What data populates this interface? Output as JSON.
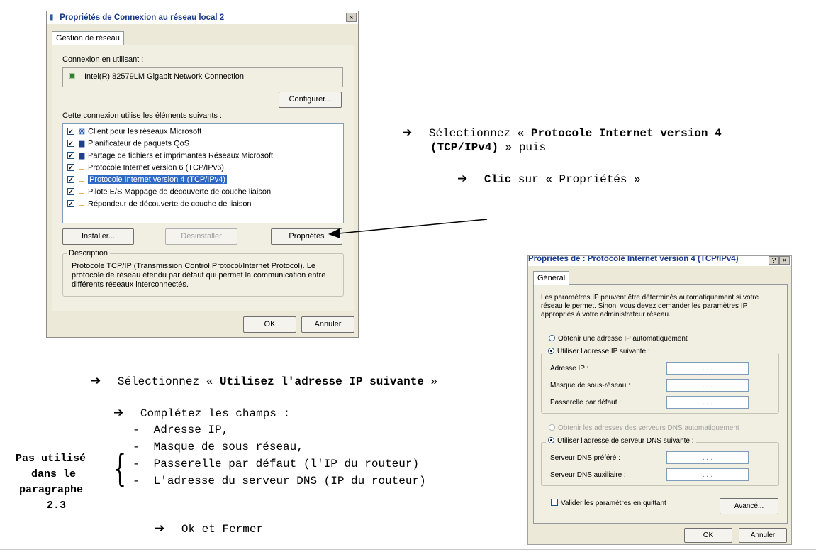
{
  "dialog1": {
    "title": "Propriétés de Connexion au réseau local 2",
    "close_glyph": "×",
    "tab": "Gestion de réseau",
    "connect_using_label": "Connexion en utilisant :",
    "adapter_name": "Intel(R) 82579LM Gigabit Network Connection",
    "configure_button": "Configurer...",
    "items_label": "Cette connexion utilise les éléments suivants :",
    "items": [
      {
        "label": "Client pour les réseaux Microsoft",
        "checked": true,
        "icon": "network-client-icon"
      },
      {
        "label": "Planificateur de paquets QoS",
        "checked": true,
        "icon": "computer-icon"
      },
      {
        "label": "Partage de fichiers et imprimantes Réseaux Microsoft",
        "checked": true,
        "icon": "computer-icon"
      },
      {
        "label": "Protocole Internet version 6 (TCP/IPv6)",
        "checked": true,
        "icon": "protocol-icon"
      },
      {
        "label": "Protocole Internet version 4 (TCP/IPv4)",
        "checked": true,
        "icon": "protocol-icon"
      },
      {
        "label": "Pilote E/S Mappage de découverte de couche liaison",
        "checked": true,
        "icon": "protocol-icon"
      },
      {
        "label": "Répondeur de découverte de couche de liaison",
        "checked": true,
        "icon": "protocol-icon"
      }
    ],
    "selected_item": 4,
    "install_button": "Installer...",
    "uninstall_button": "Désinstaller",
    "properties_button": "Propriétés",
    "description_label": "Description",
    "description_text_1": "Protocole TCP/IP (Transmission Control Protocol/Internet Protocol). Le",
    "description_text_2": "protocole de réseau étendu par défaut qui permet la communication entre",
    "description_text_3": "différents réseaux interconnectés.",
    "ok_button": "OK",
    "cancel_button": "Annuler"
  },
  "dialog2": {
    "title": "Propriétés de : Protocole Internet version 4 (TCP/IPv4)",
    "help_glyph": "?",
    "close_glyph": "×",
    "tab": "Général",
    "intro_1": "Les paramètres IP peuvent être déterminés automatiquement si votre",
    "intro_2": "réseau le permet. Sinon, vous devez demander les paramètres IP",
    "intro_3": "appropriés à votre administrateur réseau.",
    "auto_ip_radio": "Obtenir une adresse IP automatiquement",
    "manual_ip_radio": "Utiliser l'adresse IP suivante :",
    "ip_label": "Adresse IP :",
    "mask_label": "Masque de sous-réseau :",
    "gateway_label": "Passerelle par défaut :",
    "ip_placeholder": ".    .    .",
    "auto_dns_radio": "Obtenir les adresses des serveurs DNS automatiquement",
    "manual_dns_radio": "Utiliser l'adresse de serveur DNS suivante :",
    "dns_preferred_label": "Serveur DNS préféré :",
    "dns_alternate_label": "Serveur DNS auxiliaire :",
    "validate_checkbox": "Valider les paramètres en quittant",
    "advanced_button": "Avancé...",
    "ok_button": "OK",
    "cancel_button": "Annuler"
  },
  "annotations": {
    "arrow_glyph": "➔",
    "step1_pre": "Sélectionnez « ",
    "step1_bold": "Protocole Internet version 4",
    "step1_bold2": "(TCP/IPv4)",
    "step1_post": " » puis",
    "step2_bold": "Clic",
    "step2_post": " sur « Propriétés »",
    "step3_pre": "Sélectionnez « ",
    "step3_bold": "Utilisez l'adresse IP suivante",
    "step3_post": " »",
    "step4": "Complétez les champs :",
    "fields": [
      "Adresse IP,",
      "Masque de sous réseau,",
      "Passerelle par défaut (l'IP du routeur)",
      "L'adresse du serveur DNS (IP du routeur)"
    ],
    "bullet": "-",
    "side_note": [
      "Pas utilisé",
      "dans le",
      "paragraphe",
      "2.3"
    ],
    "step5": "Ok et Fermer",
    "brace": "{"
  }
}
